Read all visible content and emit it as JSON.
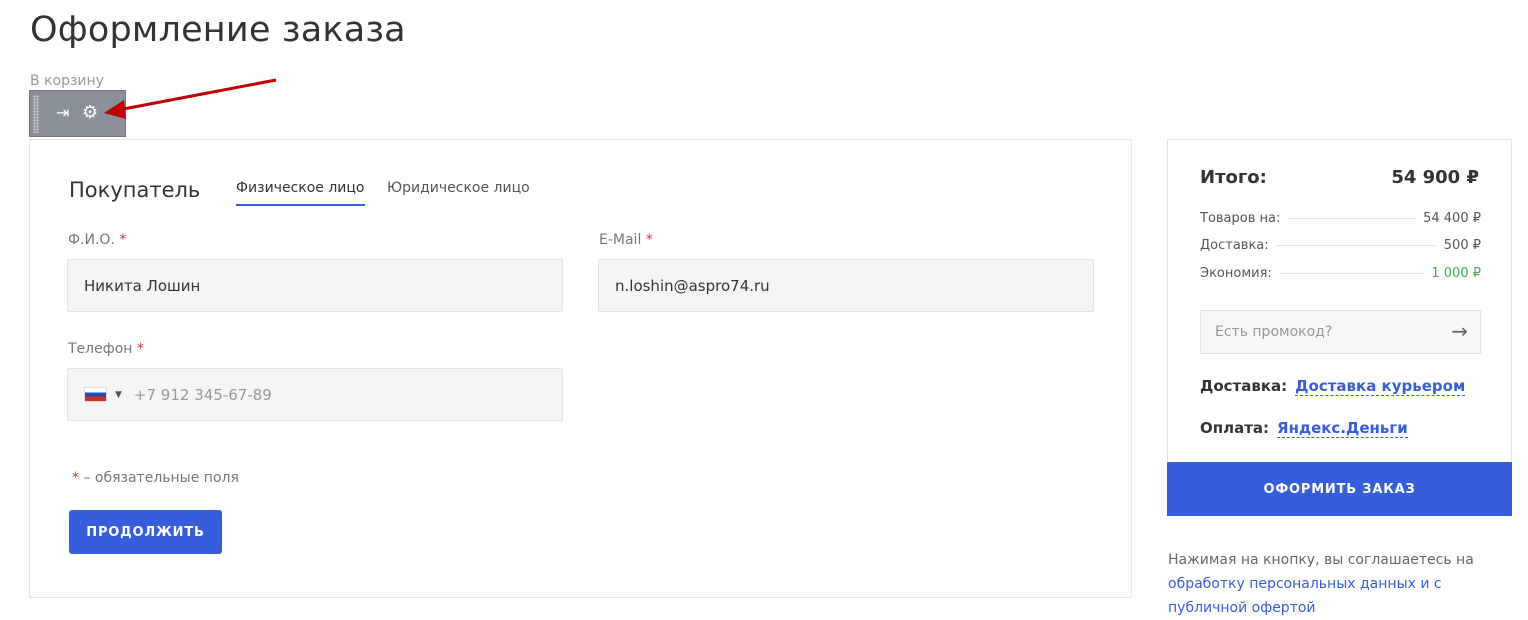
{
  "page": {
    "title": "Оформление заказа",
    "back_link": "В корзину"
  },
  "buyer": {
    "title": "Покупатель",
    "tabs": [
      {
        "label": "Физическое лицо",
        "active": true
      },
      {
        "label": "Юридическое лицо",
        "active": false
      }
    ],
    "fields": {
      "fio": {
        "label": "Ф.И.О.",
        "required_mark": "*",
        "value": "Никита Лошин"
      },
      "email": {
        "label": "E-Mail",
        "required_mark": "*",
        "value": "n.loshin@aspro74.ru"
      },
      "phone": {
        "label": "Телефон",
        "required_mark": "*",
        "placeholder": "+7 912 345-67-89",
        "country_flag": "russia-flag-icon"
      }
    },
    "required_note_mark": "*",
    "required_note": "– обязательные поля",
    "continue_button": "ПРОДОЛЖИТЬ"
  },
  "summary": {
    "total_label": "Итого:",
    "total_value": "54 900 ₽",
    "rows": [
      {
        "label": "Товаров на:",
        "value": "54 400 ₽"
      },
      {
        "label": "Доставка:",
        "value": "500 ₽"
      },
      {
        "label": "Экономия:",
        "value": "1 000 ₽"
      }
    ],
    "promo_placeholder": "Есть промокод?",
    "promo_arrow": "→",
    "delivery_label": "Доставка:",
    "delivery_value": "Доставка курьером",
    "payment_label": "Оплата:",
    "payment_value": "Яндекс.Деньги",
    "order_button": "ОФОРМИТЬ ЗАКАЗ",
    "agreement": {
      "text": "Нажимая на кнопку, вы соглашаетесь на",
      "link1": "обработку персональных данных",
      "conj": "и с",
      "link2": "публичной офертой"
    }
  },
  "toolbar": {
    "pin_icon": "⇥",
    "gear_icon": "⚙"
  },
  "colors": {
    "accent": "#365edc",
    "required": "#e03030",
    "economy": "#3fae4e",
    "annotation_arrow": "#c00000"
  }
}
